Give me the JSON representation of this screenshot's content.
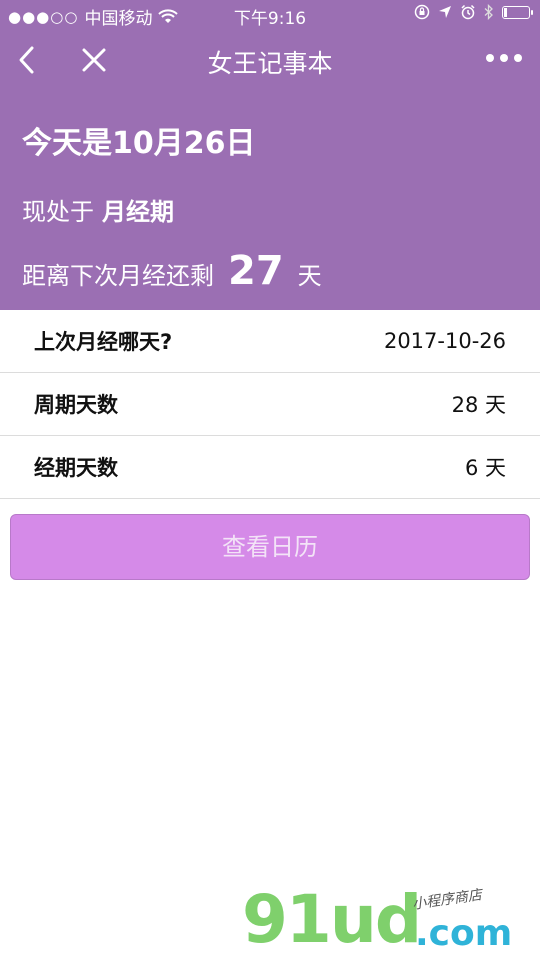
{
  "status_bar": {
    "signal": "●●●○○",
    "carrier": "中国移动",
    "time": "下午9:16",
    "battery_level": 0.12
  },
  "nav": {
    "title": "女王记事本"
  },
  "summary": {
    "today": "今天是10月26日",
    "phase_prefix": "现处于",
    "phase_value": "月经期",
    "countdown_prefix": "距离下次月经还剩",
    "countdown_days": "27",
    "countdown_unit": "天"
  },
  "settings": [
    {
      "label": "上次月经哪天?",
      "value": "2017-10-26"
    },
    {
      "label": "周期天数",
      "value": "28 天"
    },
    {
      "label": "经期天数",
      "value": "6 天"
    }
  ],
  "actions": {
    "view_calendar": "查看日历"
  },
  "watermark": {
    "brand": "91ud",
    "domain": ".com",
    "tagline": "小程序商店"
  },
  "colors": {
    "header": "#9b6fb3",
    "button": "#d58ae8",
    "watermark_green": "#7fd06c",
    "watermark_blue": "#2fb3d8"
  }
}
